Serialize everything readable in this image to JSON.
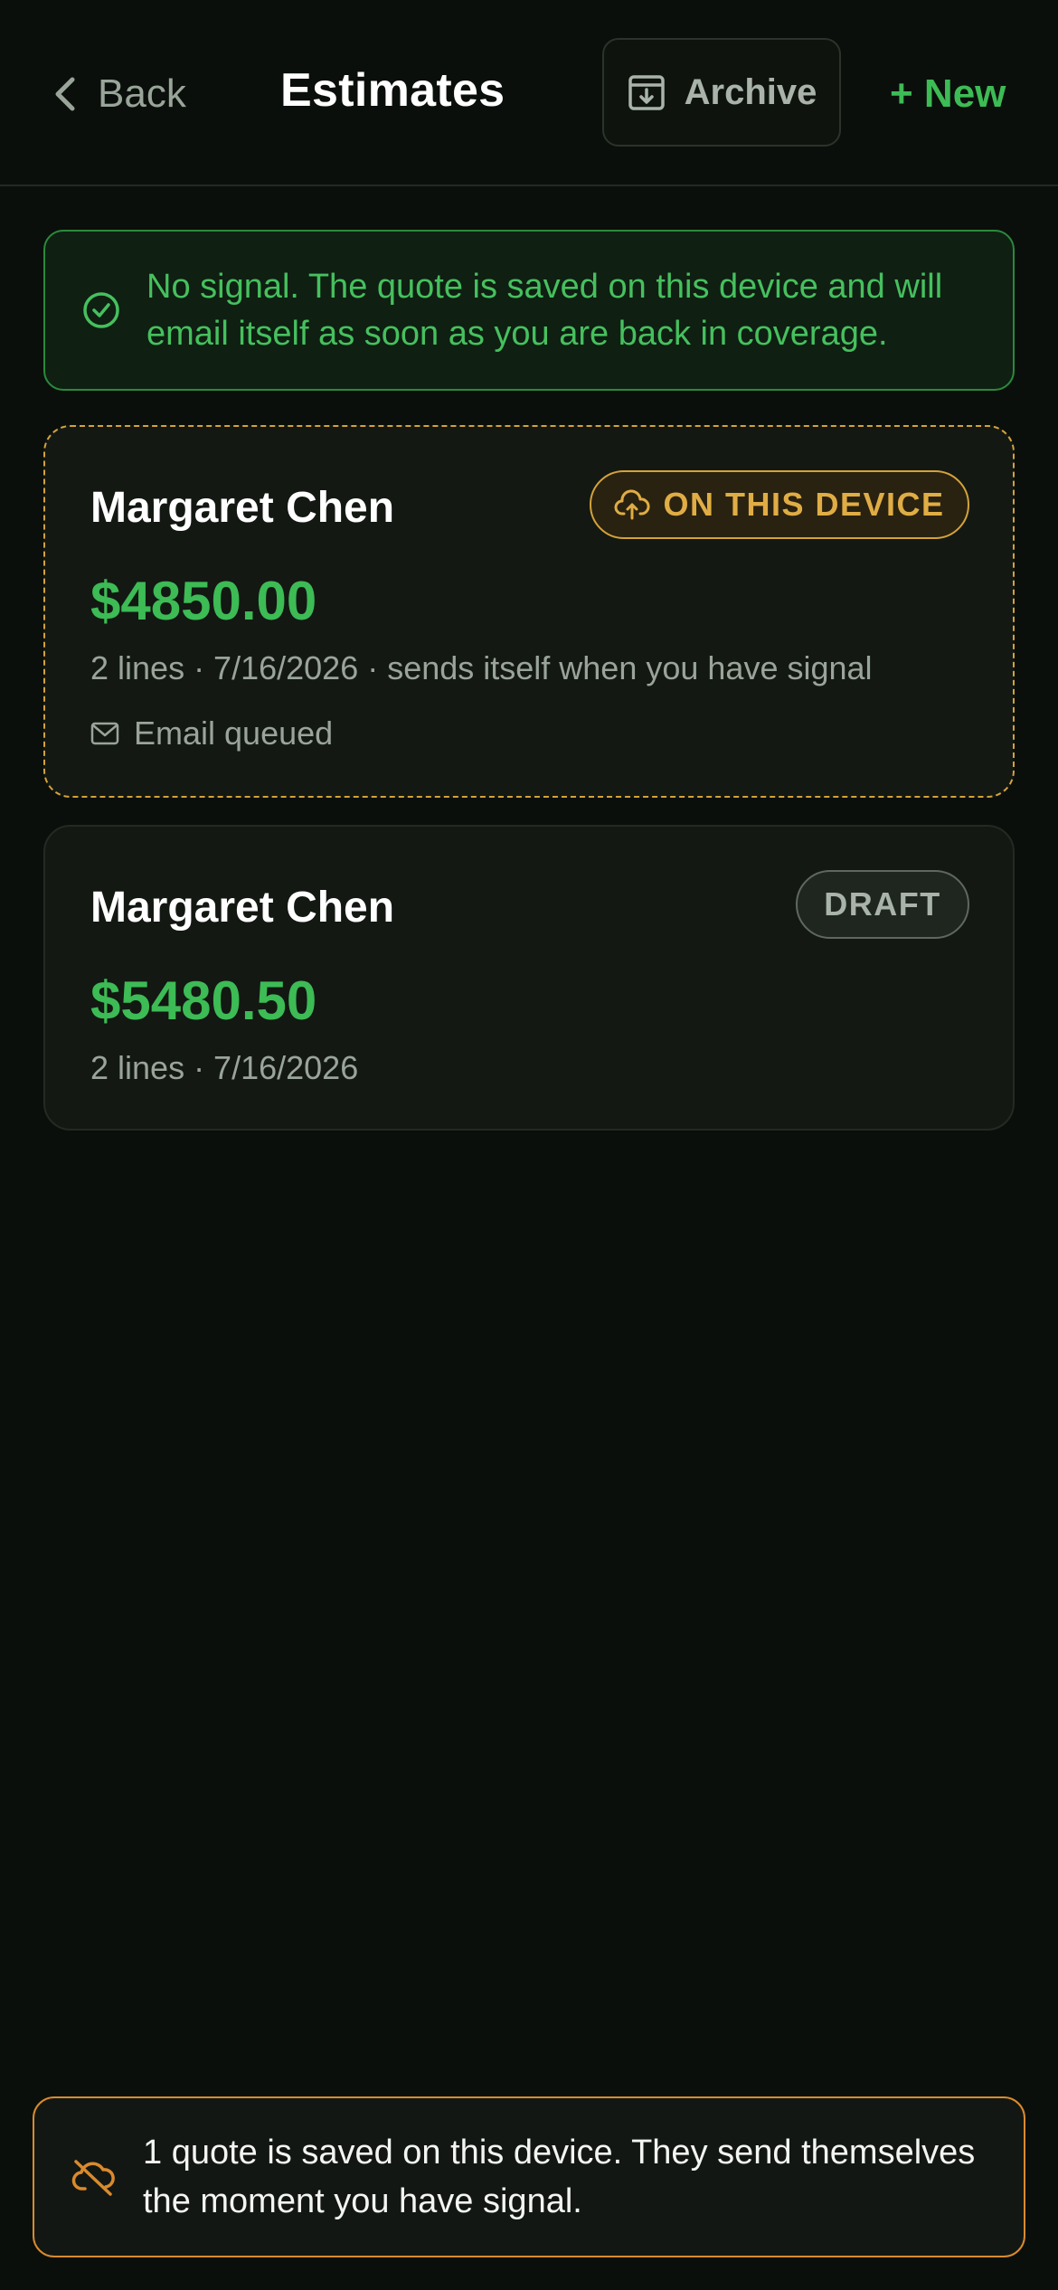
{
  "header": {
    "back_label": "Back",
    "title": "Estimates",
    "archive_label": "Archive",
    "new_label": "+ New"
  },
  "banner": {
    "text": "No signal. The quote is saved on this device and will email itself as soon as you are back in coverage."
  },
  "estimates": [
    {
      "client": "Margaret Chen",
      "amount": "$4850.00",
      "meta": "2 lines · 7/16/2026 · sends itself when you have signal",
      "status": "ON THIS DEVICE",
      "email_status": "Email queued"
    },
    {
      "client": "Margaret Chen",
      "amount": "$5480.50",
      "meta": "2 lines · 7/16/2026",
      "status": "DRAFT"
    }
  ],
  "toast": {
    "text": "1 quote is saved on this device. They send themselves the moment you have signal."
  },
  "colors": {
    "background": "#0b0f0b",
    "accent_green": "#3dbb55",
    "pending_amber": "#d4a23a",
    "toast_border": "#d98a2e"
  },
  "icons": {
    "back": "chevron-left-icon",
    "archive": "archive-icon",
    "banner": "check-circle-icon",
    "device_badge": "cloud-upload-icon",
    "email": "mail-icon",
    "toast": "cloud-off-icon"
  }
}
